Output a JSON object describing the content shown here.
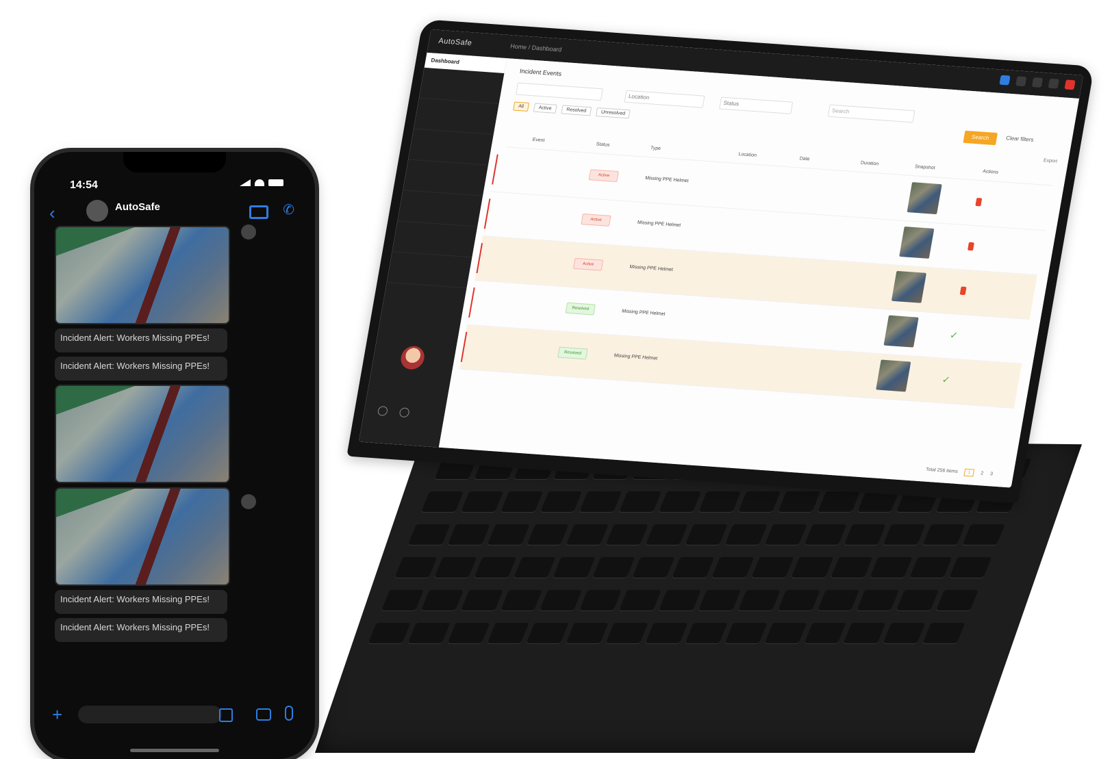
{
  "laptop": {
    "logo": "AutoSafe",
    "breadcrumb": "Home / Dashboard",
    "sidebar": {
      "active": "Dashboard",
      "items": [
        "",
        "",
        "",
        "",
        "",
        "",
        ""
      ],
      "user_name": ""
    },
    "page_title": "Incident Events",
    "filters": [
      {
        "label": "",
        "value": ""
      },
      {
        "label": "Location",
        "value": ""
      },
      {
        "label": "Status",
        "value": ""
      }
    ],
    "search_placeholder": "Search",
    "search_button": "Search",
    "clear_button": "Clear filters",
    "chips": [
      "All",
      "Active",
      "Resolved",
      "Unresolved"
    ],
    "export_label": "Export",
    "columns": [
      "Event",
      "Status",
      "Type",
      "Location",
      "Date",
      "Duration",
      "Snapshot",
      "Actions"
    ],
    "rows": [
      {
        "id": "",
        "status": "Active",
        "status_kind": "open",
        "type": "Missing PPE Helmet",
        "location": "",
        "date": "",
        "duration": "",
        "resolved": false,
        "highlight": false
      },
      {
        "id": "",
        "status": "Active",
        "status_kind": "open",
        "type": "Missing PPE Helmet",
        "location": "",
        "date": "",
        "duration": "",
        "resolved": false,
        "highlight": false
      },
      {
        "id": "",
        "status": "Active",
        "status_kind": "open",
        "type": "Missing PPE Helmet",
        "location": "",
        "date": "",
        "duration": "",
        "resolved": false,
        "highlight": true
      },
      {
        "id": "",
        "status": "Resolved",
        "status_kind": "resolved",
        "type": "Missing PPE Helmet",
        "location": "",
        "date": "",
        "duration": "",
        "resolved": true,
        "highlight": false
      },
      {
        "id": "",
        "status": "Resolved",
        "status_kind": "resolved",
        "type": "Missing PPE Helmet",
        "location": "",
        "date": "",
        "duration": "",
        "resolved": true,
        "highlight": true
      }
    ],
    "pager": {
      "total": "Total 256 items",
      "pages": [
        "1",
        "2",
        "3"
      ],
      "current": "1"
    }
  },
  "phone": {
    "time": "14:54",
    "contact_name": "AutoSafe",
    "contact_sub": "",
    "messages": [
      {
        "kind": "image"
      },
      {
        "kind": "text",
        "text": "Incident Alert: Workers Missing PPEs!",
        "time": ""
      },
      {
        "kind": "text",
        "text": "Incident Alert: Workers Missing PPEs!",
        "time": ""
      },
      {
        "kind": "image"
      },
      {
        "kind": "image"
      },
      {
        "kind": "text",
        "text": "Incident Alert: Workers Missing PPEs!",
        "time": ""
      },
      {
        "kind": "text",
        "text": "Incident Alert: Workers Missing PPEs!",
        "time": ""
      }
    ]
  },
  "colors": {
    "accent": "#f5a623",
    "alert": "#e0332b",
    "ios_blue": "#2f7de1",
    "resolved": "#56b04a"
  }
}
